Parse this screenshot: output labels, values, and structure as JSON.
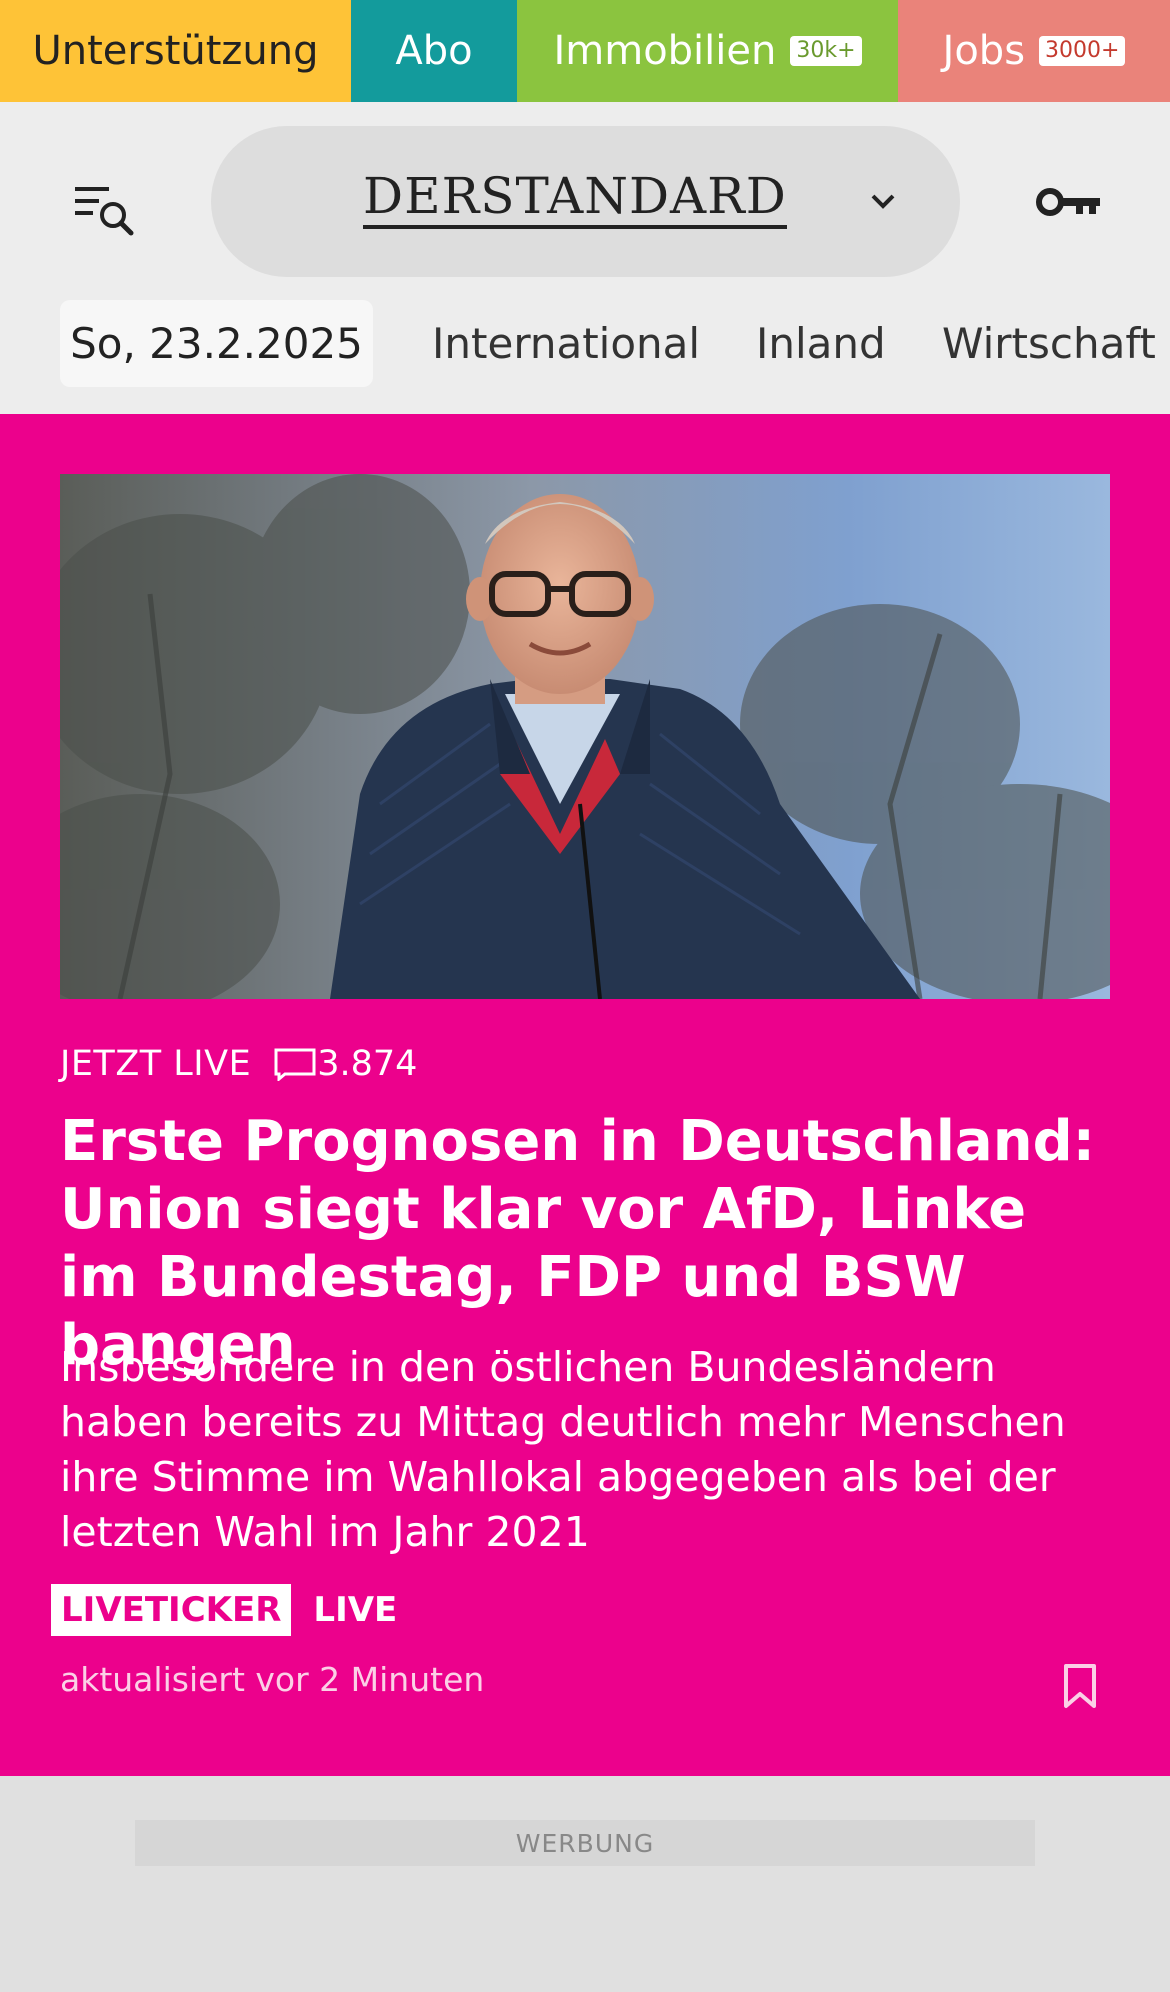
{
  "promo": {
    "support": "Unterstützung",
    "abo": "Abo",
    "immobilien": "Immobilien",
    "immobilien_badge": "30k+",
    "jobs": "Jobs",
    "jobs_badge": "3000+"
  },
  "header": {
    "logo": "DERSTANDARD",
    "menu_icon": "menu-search-icon",
    "key_icon": "key-icon"
  },
  "nav": {
    "date": "So, 23.2.2025",
    "items": [
      "International",
      "Inland",
      "Wirtschaft"
    ]
  },
  "hero": {
    "kicker": "JETZT LIVE",
    "comment_count": "3.874",
    "headline": "Erste Prognosen in Deutschland: Union siegt klar vor AfD, Linke im Bundestag, FDP und BSW bangen",
    "teaser": "Insbesondere in den östlichen Bundesländern haben bereits zu Mittag deutlich mehr Menschen ihre Stimme im Wahllokal abgegeben als bei der letzten Wahl im Jahr 2021",
    "tag_ticker": "LIVETICKER",
    "tag_live": "LIVE",
    "updated": "aktualisiert vor 2 Minuten"
  },
  "ad": {
    "label": "WERBUNG"
  },
  "colors": {
    "support": "#fec337",
    "abo": "#139b9c",
    "immobilien": "#8bc43f",
    "jobs": "#ea837a",
    "hero_bg": "#ec018c"
  }
}
